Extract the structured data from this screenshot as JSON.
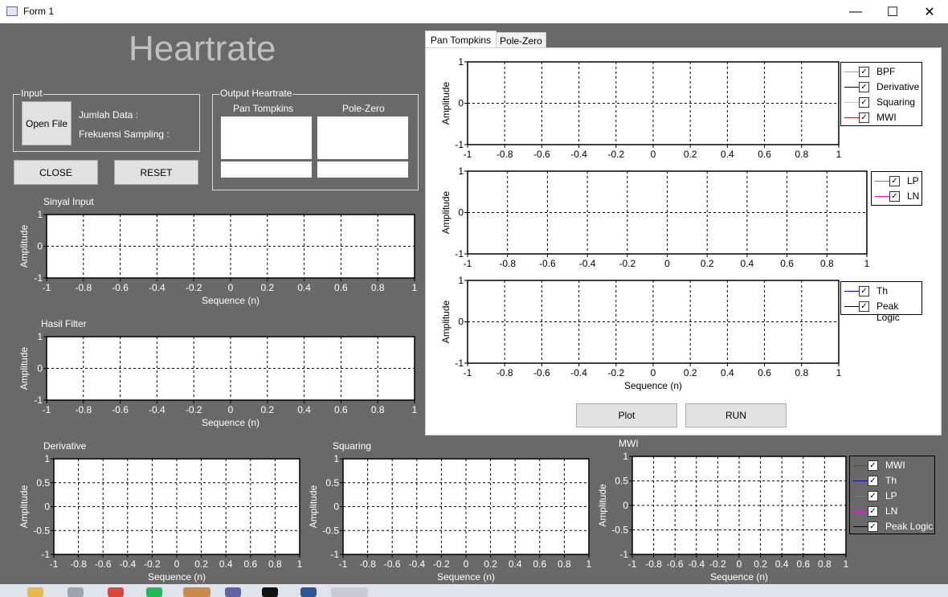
{
  "window": {
    "title": "Form 1",
    "minimize": "—",
    "maximize": "☐",
    "close": "✕"
  },
  "heading": "Heartrate",
  "input_group": {
    "title": "Input",
    "open_file": "Open File",
    "jumlah_data": "Jumlah Data :",
    "frekuensi": "Frekuensi Sampling :"
  },
  "buttons": {
    "close": "CLOSE",
    "reset": "RESET",
    "plot": "Plot",
    "run": "RUN"
  },
  "output_group": {
    "title": "Output Heartrate",
    "col1": "Pan Tompkins",
    "col2": "Pole-Zero"
  },
  "tabs": [
    "Pan Tompkins",
    "Pole-Zero"
  ],
  "charts": {
    "sinyal_input": {
      "title": "Sinyal Input",
      "ylabel": "Amplitude",
      "xlabel": "Sequence (n)"
    },
    "hasil_filter": {
      "title": "Hasil Filter",
      "ylabel": "Amplitude",
      "xlabel": "Sequence (n)"
    },
    "derivative": {
      "title": "Derivative",
      "ylabel": "Amplitude",
      "xlabel": "Sequence (n)"
    },
    "squaring": {
      "title": "Squaring",
      "ylabel": "Amplitude",
      "xlabel": "Sequence (n)"
    },
    "mwi": {
      "title": "MWI",
      "ylabel": "Amplitude",
      "xlabel": "Sequence (n)"
    },
    "pt1": {
      "title": "",
      "ylabel": "Amplitude",
      "xlabel": ""
    },
    "pt2": {
      "title": "",
      "ylabel": "Amplitude",
      "xlabel": ""
    },
    "pt3": {
      "title": "",
      "ylabel": "Amplitude",
      "xlabel": "Sequence (n)"
    }
  },
  "ticks": {
    "x": [
      "-1",
      "-0.8",
      "-0.6",
      "-0.4",
      "-0.2",
      "0",
      "0.2",
      "0.4",
      "0.6",
      "0.8",
      "1"
    ],
    "y3": [
      "1",
      "0",
      "-1"
    ],
    "y5": [
      "1",
      "0.5",
      "0",
      "-0.5",
      "-1"
    ]
  },
  "legends": {
    "pt1": [
      {
        "label": "BPF",
        "color": "#ff8c00"
      },
      {
        "label": "Derivative",
        "color": "#000000"
      },
      {
        "label": "Squaring",
        "color": "#ffd700"
      },
      {
        "label": "MWI",
        "color": "#b22222"
      }
    ],
    "pt2": [
      {
        "label": "LP",
        "color": "#00cc00"
      },
      {
        "label": "LN",
        "color": "#ff00ff"
      }
    ],
    "pt3": [
      {
        "label": "Th",
        "color": "#0000cd"
      },
      {
        "label": "Peak Logic",
        "color": "#000000"
      }
    ],
    "mwi": [
      {
        "label": "MWI",
        "color": "#b22222"
      },
      {
        "label": "Th",
        "color": "#0000cd"
      },
      {
        "label": "LP",
        "color": "#00cc00"
      },
      {
        "label": "LN",
        "color": "#ff00ff"
      },
      {
        "label": "Peak Logic",
        "color": "#000000"
      }
    ]
  },
  "checkmark": "✓"
}
